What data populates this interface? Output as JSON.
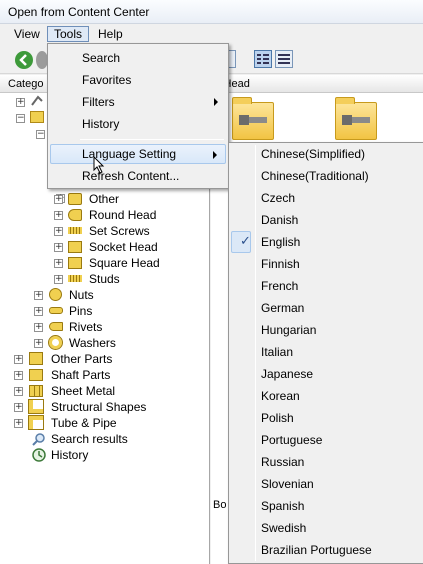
{
  "window": {
    "title": "Open from Content Center"
  },
  "menubar": {
    "view": "View",
    "tools": "Tools",
    "help": "Help"
  },
  "left_pane": {
    "header": "Catego",
    "tree": [
      {
        "label": "Other",
        "icon": "other-icon"
      },
      {
        "label": "Round Head",
        "icon": "round-head-icon"
      },
      {
        "label": "Set Screws",
        "icon": "set-screw-icon"
      },
      {
        "label": "Socket Head",
        "icon": "socket-head-icon"
      },
      {
        "label": "Square Head",
        "icon": "square-head-icon"
      },
      {
        "label": "Studs",
        "icon": "stud-icon"
      },
      {
        "label": "Nuts",
        "icon": "nut-icon"
      },
      {
        "label": "Pins",
        "icon": "pin-icon"
      },
      {
        "label": "Rivets",
        "icon": "rivet-icon"
      },
      {
        "label": "Washers",
        "icon": "washer-icon"
      },
      {
        "label": "Other Parts",
        "icon": "other-parts-icon"
      },
      {
        "label": "Shaft Parts",
        "icon": "shaft-parts-icon"
      },
      {
        "label": "Sheet Metal",
        "icon": "sheet-metal-icon"
      },
      {
        "label": "Structural Shapes",
        "icon": "structural-shapes-icon"
      },
      {
        "label": "Tube & Pipe",
        "icon": "tube-pipe-icon"
      },
      {
        "label": "Search results",
        "icon": "search-results-icon"
      },
      {
        "label": "History",
        "icon": "history-icon"
      }
    ]
  },
  "right_pane": {
    "header": "k Head",
    "footer_fragment": "Bo"
  },
  "tools_menu": {
    "items": [
      {
        "label": "Search"
      },
      {
        "label": "Favorites"
      },
      {
        "label": "Filters"
      },
      {
        "label": "History"
      },
      {
        "label": "Language Setting"
      },
      {
        "label": "Refresh Content..."
      }
    ]
  },
  "language_submenu": {
    "checked": "English",
    "items": [
      "Chinese(Simplified)",
      "Chinese(Traditional)",
      "Czech",
      "Danish",
      "English",
      "Finnish",
      "French",
      "German",
      "Hungarian",
      "Italian",
      "Japanese",
      "Korean",
      "Polish",
      "Portuguese",
      "Russian",
      "Slovenian",
      "Spanish",
      "Swedish",
      "Brazilian Portuguese"
    ],
    "check_glyph": "✓"
  },
  "colors": {
    "highlight": "#d9e8f9",
    "folder": "#f2c443",
    "check": "#2a4f8c"
  }
}
